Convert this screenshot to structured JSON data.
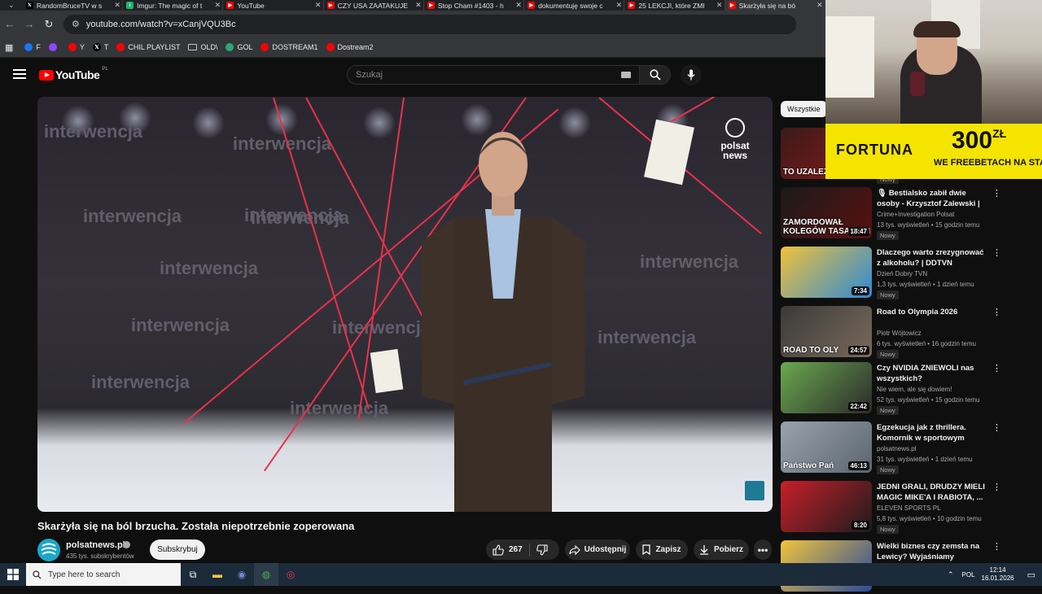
{
  "browser": {
    "tabs": [
      {
        "label": "RandomBruceTV w s",
        "favicon": "x-icon",
        "active": false
      },
      {
        "label": "Imgur: The magic of t",
        "favicon": "imgur-icon",
        "active": false
      },
      {
        "label": "YouTube",
        "favicon": "youtube-icon",
        "active": false
      },
      {
        "label": "CZY USA ZAATAKUJE",
        "favicon": "youtube-icon",
        "active": false
      },
      {
        "label": "Stop Cham #1403 - h",
        "favicon": "youtube-icon",
        "active": false
      },
      {
        "label": "dokumentuję swoje c",
        "favicon": "youtube-icon",
        "active": false
      },
      {
        "label": "25 LEKCJI, które ZMI",
        "favicon": "youtube-icon",
        "active": false
      },
      {
        "label": "Skarżyła się na bó",
        "favicon": "youtube-icon",
        "active": true
      }
    ],
    "url": "youtube.com/watch?v=xCanjVQU3Bc",
    "bookmarks": [
      {
        "label": "F",
        "icon": "facebook-icon",
        "color": "#1877f2"
      },
      {
        "label": "",
        "icon": "twitch-icon",
        "color": "#9146ff"
      },
      {
        "label": "Y",
        "icon": "youtube-icon",
        "color": "#ff0000"
      },
      {
        "label": "T",
        "icon": "x-icon",
        "color": "#000000"
      },
      {
        "label": "CHIL PLAYLIST",
        "icon": "youtube-icon",
        "color": "#ff0000"
      },
      {
        "label": "OLD\\",
        "icon": "folder-icon",
        "color": "#35363a"
      },
      {
        "label": "GOL",
        "icon": "gol-icon",
        "color": "#2aa876"
      },
      {
        "label": "DOSTREAM1",
        "icon": "youtube-icon",
        "color": "#ff0000"
      },
      {
        "label": "Dostream2",
        "icon": "youtube-icon",
        "color": "#ff0000"
      }
    ]
  },
  "youtube": {
    "logo_text": "YouTube",
    "country_code": "PL",
    "search_placeholder": "Szukaj",
    "video": {
      "title": "Skarżyła się na ból brzucha. Została niepotrzebnie zoperowana",
      "channel": "polsatnews.pl",
      "subscribers": "435 tys. subskrybentów",
      "subscribe_label": "Subskrybuj",
      "likes": "267",
      "share_label": "Udostępnij",
      "save_label": "Zapisz",
      "download_label": "Pobierz",
      "watermarks": [
        "interwencja",
        "interwencja",
        "interwencja",
        "interwencja",
        "interwencja",
        "interwencja",
        "interwencja",
        "interwencja",
        "interwencja",
        "interwencja",
        "interwencja",
        "interwencja"
      ],
      "logo_lines": [
        "polsat",
        "news"
      ]
    },
    "chip_all": "Wszystkie",
    "recommendations": [
      {
        "title": "",
        "channel": "",
        "meta": "",
        "badge": "Nowy",
        "duration": "",
        "thumb_text": "TO UZALEŻNIENIE",
        "colors": [
          "#3a1a1a",
          "#8b1b1b"
        ]
      },
      {
        "title": "🎙 Bestialsko zabił dwie osoby - Krzysztof Zalewski | ...",
        "channel": "Crime+Investigation Polsat",
        "meta": "13 tys. wyświetleń • 15 godzin temu",
        "badge": "Nowy",
        "duration": "18:47",
        "thumb_text": "ZAMORDOWAŁ KOLEGÓW TASAKIEM",
        "colors": [
          "#1b1b1b",
          "#5a1010"
        ]
      },
      {
        "title": "Dlaczego warto zrezygnować z alkoholu? | DDTVN",
        "channel": "Dzień Dobry TVN",
        "meta": "1,3 tys. wyświetleń • 1 dzień temu",
        "badge": "Nowy",
        "duration": "7:34",
        "thumb_text": "",
        "colors": [
          "#f0c23a",
          "#2e8ad6"
        ]
      },
      {
        "title": "Road to Olympia 2026",
        "channel": "Piotr Wójtowicz",
        "meta": "6 tys. wyświetleń • 16 godzin temu",
        "badge": "Nowy",
        "duration": "24:57",
        "thumb_text": "ROAD TO OLY",
        "colors": [
          "#3a3a3a",
          "#7a6a5a"
        ]
      },
      {
        "title": "Czy NVIDIA ZNIEWOLI nas wszystkich?",
        "channel": "Nie wiem, ale się dowiem!",
        "meta": "52 tys. wyświetleń • 15 godzin temu",
        "badge": "Nowy",
        "duration": "22:42",
        "thumb_text": "",
        "colors": [
          "#6aa84f",
          "#2b2b2b"
        ]
      },
      {
        "title": "Egzekucja jak z thrillera. Komornik w sportowym aucie, ...",
        "channel": "polsatnews.pl",
        "meta": "31 tys. wyświetleń • 1 dzień temu",
        "badge": "Nowy",
        "duration": "46:13",
        "thumb_text": "Państwo Pań",
        "colors": [
          "#9aa3ad",
          "#5b6570"
        ]
      },
      {
        "title": "JEDNI GRALI, DRUDZY MIELI MAGIC MIKE'A I RABIOTA, ...",
        "channel": "ELEVEN SPORTS PL",
        "meta": "5,8 tys. wyświetleń • 10 godzin temu",
        "badge": "Nowy",
        "duration": "8:20",
        "thumb_text": "",
        "colors": [
          "#c81f2a",
          "#1c1c1c"
        ]
      },
      {
        "title": "Wielki biznes czy zemsta na Lewicy? Wyjaśniamy awanturę...",
        "channel": "",
        "meta": "",
        "badge": "",
        "duration": "",
        "thumb_text": "",
        "colors": [
          "#f2c43a",
          "#2a4a9a"
        ]
      }
    ]
  },
  "overlay": {
    "ad_brand": "FORTUNA",
    "ad_amount": "300",
    "ad_currency": "ZŁ",
    "ad_line": "WE FREEBETACH NA START"
  },
  "taskbar": {
    "search_placeholder": "Type here to search",
    "language": "POL",
    "time": "12:14",
    "date": "16.01.2026"
  }
}
